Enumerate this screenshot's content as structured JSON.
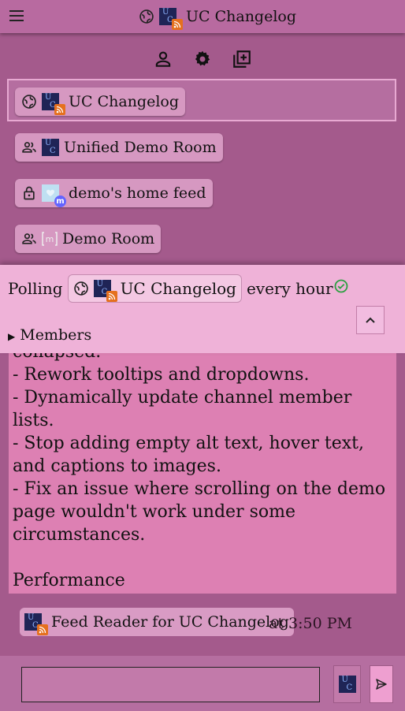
{
  "topbar": {
    "title": "UC Changelog"
  },
  "rooms": [
    {
      "name": "UC Changelog",
      "type": "public",
      "service": "rss"
    },
    {
      "name": "Unified Demo Room",
      "type": "group",
      "service": "uc"
    },
    {
      "name": "demo's home feed",
      "type": "private",
      "service": "mastodon"
    },
    {
      "name": "Demo Room",
      "type": "group",
      "service": "matrix"
    }
  ],
  "message": {
    "lines": "collapsed.\n- Rework tooltips and dropdowns.\n- Dynamically update channel member lists.\n- Stop adding empty alt text, hover text, and captions to images.\n- Fix an issue where scrolling on the demo page wouldn't work under some circumstances.\n\nPerformance\n- Improve UI performance by caching data and hiding off-screen messages."
  },
  "polling": {
    "prefix": "Polling",
    "room": "UC Changelog",
    "suffix": "every hour",
    "members_label": "Members"
  },
  "sender": {
    "name": "Feed Reader for UC Changelog",
    "time": "at 3:50 PM"
  },
  "composer": {
    "placeholder": ""
  },
  "colors": {
    "rss": "#e5701e",
    "uc_bg": "#1f2456",
    "check": "#2ea043",
    "mastodon": "#6364ff"
  }
}
